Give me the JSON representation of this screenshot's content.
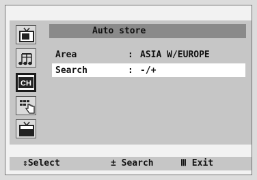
{
  "menu": {
    "title": "Auto store",
    "rows": [
      {
        "label": "Area",
        "separator": ":",
        "value": "ASIA W/EUROPE"
      },
      {
        "label": "Search",
        "separator": ":",
        "value": "-/+"
      }
    ],
    "highlighted_row": "Search"
  },
  "side_icons": [
    {
      "name": "picture-icon"
    },
    {
      "name": "sound-icon"
    },
    {
      "name": "channel-icon",
      "label": "CH",
      "active": true
    },
    {
      "name": "setup-icon"
    },
    {
      "name": "input-icon"
    }
  ],
  "help": {
    "select": {
      "glyph": "⇕",
      "label": "Select"
    },
    "search": {
      "glyph": "±",
      "label": "Search"
    },
    "exit": {
      "glyph": "Ⅲ",
      "label": "Exit"
    }
  },
  "colors": {
    "panel": "#c6c6c6",
    "title_bar": "#8a8a8a",
    "highlight": "#ffffff",
    "text": "#111111"
  }
}
